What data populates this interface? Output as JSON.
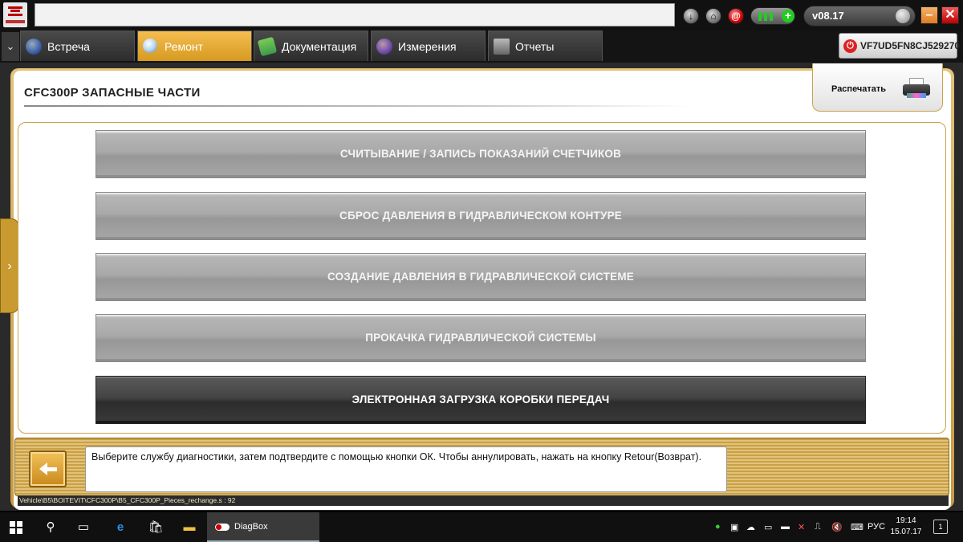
{
  "app": {
    "brand_logo": "citroen-logo",
    "version": "v08.17",
    "vin": "VF7UD5FN8CJ529270"
  },
  "tabs": [
    {
      "label": "Встреча",
      "icon": "globe-icon",
      "color": "#3a5fa8"
    },
    {
      "label": "Ремонт",
      "icon": "magnifier-icon",
      "color": "#e9b642"
    },
    {
      "label": "Документация",
      "icon": "book-icon",
      "color": "#3f9a4c"
    },
    {
      "label": "Измерения",
      "icon": "waveform-icon",
      "color": "#6b4ca8"
    },
    {
      "label": "Отчеты",
      "icon": "report-icon",
      "color": "#777777"
    }
  ],
  "page": {
    "title": "CFC300P  ЗАПАСНЫЕ ЧАСТИ",
    "print_label": "Распечатать"
  },
  "menu": [
    {
      "label": "СЧИТЫВАНИЕ / ЗАПИСЬ ПОКАЗАНИЙ СЧЕТЧИКОВ",
      "selected": false
    },
    {
      "label": "СБРОС ДАВЛЕНИЯ В ГИДРАВЛИЧЕСКОМ КОНТУРЕ",
      "selected": false
    },
    {
      "label": "СОЗДАНИЕ ДАВЛЕНИЯ В ГИДРАВЛИЧЕСКОЙ СИСТЕМЕ",
      "selected": false
    },
    {
      "label": "ПРОКАЧКА ГИДРАВЛИЧЕСКОЙ СИСТЕМЫ",
      "selected": false
    },
    {
      "label": "ЭЛЕКТРОННАЯ ЗАГРУЗКА КОРОБКИ ПЕРЕДАЧ",
      "selected": true
    }
  ],
  "footer": {
    "message": "Выберите службу диагностики, затем подтвердите с помощью кнопки ОК. Чтобы аннулировать, нажать на кнопку Retour(Возврат).",
    "path": "Vehicle\\B5\\BOITEVIT\\CFC300P\\B5_CFC300P_Pieces_rechange.s : 92"
  },
  "taskbar": {
    "app_label": "DiagBox",
    "language": "РУС",
    "time": "19:14",
    "date": "15.07.17",
    "notifications": "1"
  },
  "colors": {
    "accent_gold": "#d69a20",
    "button_gray": "#a9a9a9",
    "button_selected": "#3a3a3a"
  }
}
